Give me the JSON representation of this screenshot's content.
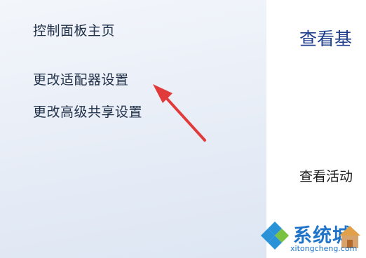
{
  "sidebar": {
    "items": [
      {
        "label": "控制面板主页"
      },
      {
        "label": "更改适配器设置"
      },
      {
        "label": "更改高级共享设置"
      }
    ]
  },
  "main": {
    "title": "查看基",
    "subtitle": "查看活动"
  },
  "annotation": {
    "arrow_color": "#e03a3a"
  },
  "watermark": {
    "brand": "系统城",
    "url": "xitongcheng.com"
  },
  "colors": {
    "link": "#1f2f48",
    "title": "#1f3e8c",
    "watermark": "#1e73c9"
  }
}
